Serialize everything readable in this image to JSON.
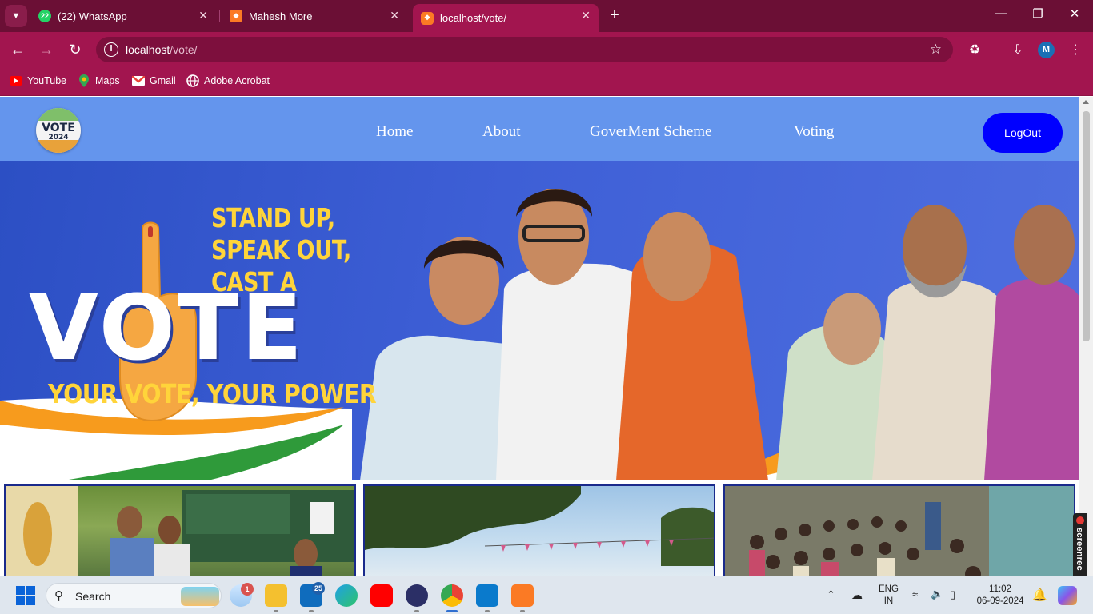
{
  "browser": {
    "tabs": [
      {
        "title": "(22) WhatsApp",
        "icon": "whatsapp-icon",
        "badge": "22"
      },
      {
        "title": "Mahesh More",
        "icon": "xampp-icon"
      },
      {
        "title": "localhost/vote/",
        "icon": "xampp-icon",
        "active": true
      }
    ],
    "url_host": "localhost",
    "url_path": "/vote/",
    "profile_initial": "M",
    "bookmarks": [
      {
        "label": "YouTube",
        "icon": "youtube-icon"
      },
      {
        "label": "Maps",
        "icon": "maps-icon"
      },
      {
        "label": "Gmail",
        "icon": "gmail-icon"
      },
      {
        "label": "Adobe Acrobat",
        "icon": "acrobat-icon"
      }
    ]
  },
  "site": {
    "logo": {
      "word": "VOTE",
      "year": "2024"
    },
    "nav": [
      "Home",
      "About",
      "GoverMent Scheme",
      "Voting"
    ],
    "logout_label": "LogOut",
    "hero": {
      "line1": "STAND UP,",
      "line2": "SPEAK OUT,",
      "line3": "CAST A",
      "big_word": "VOTE",
      "tagline": "YOUR VOTE, YOUR POWER"
    }
  },
  "taskbar": {
    "search_label": "Search",
    "weather_badge": "1",
    "outlook_badge": "25",
    "language": "ENG",
    "region": "IN",
    "time": "11:02",
    "date": "06-09-2024"
  },
  "overlay": {
    "screenrec_label": "screenrec"
  },
  "colors": {
    "tabstrip": "#6b0f35",
    "toolbar": "#a2154f",
    "site_nav": "#6495ed",
    "logout": "#0000ff",
    "hero_blue": "#3e5fd6",
    "hero_yellow": "#ffd43a"
  }
}
